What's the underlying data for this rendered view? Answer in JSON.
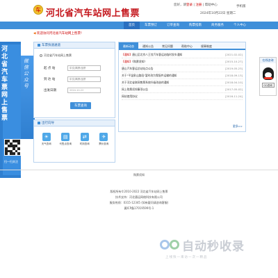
{
  "header": {
    "logo_text": "车",
    "title": "河北省汽车站网上售票",
    "userbar_prefix": "您好，请",
    "login_label": "登录",
    "separator": " | ",
    "register_label": "注册",
    "separator2": " | ",
    "help_label": "帮助中心",
    "date": "2024年10月22日",
    "weekday": "星期二",
    "mobile_label": "手机版"
  },
  "nav": {
    "items": [
      "首页",
      "车票预订",
      "订单查询",
      "购票指南",
      "商务服务",
      "个人中心"
    ],
    "active_index": 0
  },
  "notice": {
    "text": "欢迎访问河北省汽车站网上售票！"
  },
  "promo": {
    "title": "河北省汽车票网上售票",
    "vertical_text": "微信公众号",
    "caption": "扫一扫关注"
  },
  "ticket_panel": {
    "title": "车票快速通道",
    "type_label": "河北省汽车站网上售票",
    "fields": [
      {
        "label": "起 点 站",
        "placeholder": "中文/简拼/全拼"
      },
      {
        "label": "到 达 站",
        "placeholder": "中文/简拼/全拼"
      },
      {
        "label": "出发日期",
        "value": "2024-10-22"
      }
    ],
    "query_label": "车票查询"
  },
  "service_panel": {
    "title": "出行向导",
    "items": [
      {
        "icon": "weather-icon",
        "glyph": "☀",
        "label": "天气查询"
      },
      {
        "icon": "ticket-icon",
        "glyph": "▤",
        "label": "代售点查询"
      },
      {
        "icon": "route-icon",
        "glyph": "⇄",
        "label": "时刻查询"
      },
      {
        "icon": "luggage-icon",
        "glyph": "✈",
        "label": "票价查询"
      }
    ]
  },
  "news_panel": {
    "tabs": [
      "最新动态",
      "通知公告",
      "常见问题",
      "帮助中心",
      "规章制度"
    ],
    "active_tab": 0,
    "items": [
      {
        "tag": "【通知】",
        "title": "唐山至北京八王坟汽车客运站临时发车通知",
        "date": "[2021-02-02]"
      },
      {
        "tag": "【通知】",
        "title": "《购票须知》",
        "date": "[2015-10-27]"
      },
      {
        "tag": "",
        "title": "唐山汽车客运总站站点公告",
        "date": "[2019-05-23]"
      },
      {
        "tag": "",
        "title": "关于\"平温泉山路段\"暂时改为零配件运输的通知",
        "date": "[2018-09-13]"
      },
      {
        "tag": "",
        "title": "关于河北省联网售票系统升级改造的通知",
        "date": "[2018-04-10]"
      },
      {
        "tag": "",
        "title": "网上购票须知事项公告",
        "date": "[2017-05-02]"
      },
      {
        "tag": "",
        "title": "网站使用协议",
        "date": "[2016-11-24]"
      }
    ],
    "more_label": "更多>>"
  },
  "qq": {
    "title": "在线咨询",
    "button_label": "QQ咨询"
  },
  "footer": {
    "links": "购票须知",
    "lines": [
      "版权所有©2010-2022 河北省汽车站网上售票",
      "技术支持：河北唐运网络科技有限公司",
      "服务热线：0315-12345 (如有疑问请咨询客服)",
      "冀ICP备17019599号-1"
    ]
  },
  "watermark": {
    "brand": "自动秒收录",
    "sub": "上线快一来访一次一精品"
  }
}
